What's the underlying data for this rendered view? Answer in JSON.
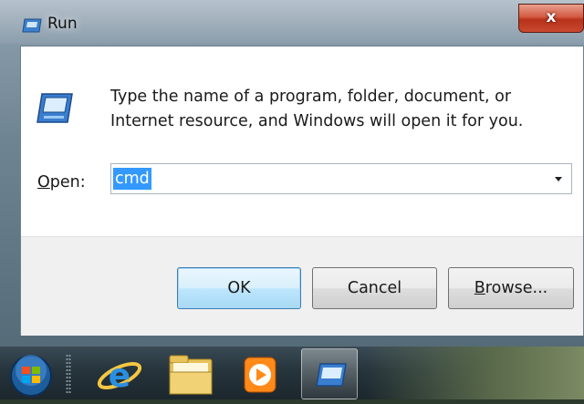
{
  "window": {
    "title": "Run",
    "close_label": "x"
  },
  "dialog": {
    "description_line1": "Type the name of a program, folder, document, or",
    "description_line2": "Internet resource, and Windows will open it for you.",
    "open_label_accel": "O",
    "open_label_rest": "pen:",
    "open_value": "cmd"
  },
  "buttons": {
    "ok_label": "OK",
    "cancel_label": "Cancel",
    "browse_accel": "B",
    "browse_rest": "rowse..."
  },
  "taskbar": {
    "items": [
      {
        "icon": "windows-start-orb-icon"
      },
      {
        "icon": "internet-explorer-icon"
      },
      {
        "icon": "file-explorer-folder-icon"
      },
      {
        "icon": "media-player-icon"
      },
      {
        "icon": "run-dialog-icon",
        "active": true
      }
    ]
  },
  "colors": {
    "selection": "#3399ff",
    "default_button_border": "#3c7fb1",
    "close_button": "#c8492f"
  }
}
